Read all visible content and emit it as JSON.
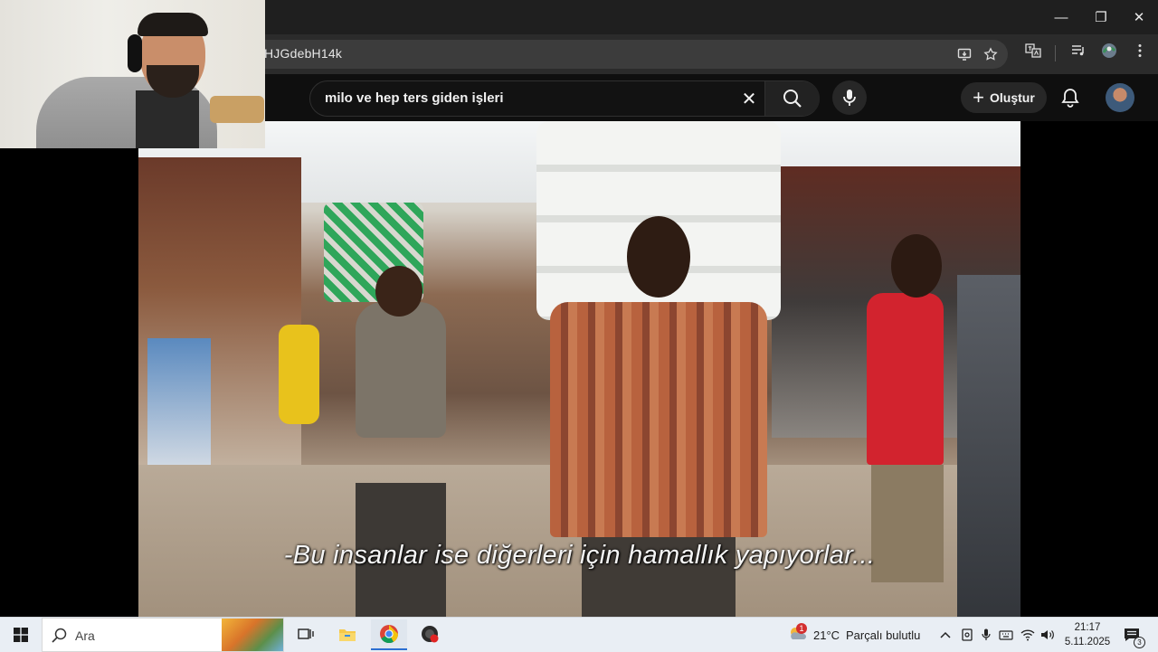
{
  "browser": {
    "window_controls": {
      "minimize": "—",
      "restore": "❐",
      "close": "✕"
    },
    "url_visible": "HJGdebH14k"
  },
  "youtube": {
    "search_query": "milo ve hep ters giden işleri",
    "clear_symbol": "✕",
    "create_label": "Oluştur",
    "create_plus": "+"
  },
  "video": {
    "subtitle": "-Bu insanlar ise diğerleri için hamallık yapıyorlar..."
  },
  "taskbar": {
    "search_placeholder": "Ara",
    "weather": {
      "temperature": "21°C",
      "condition": "Parçalı bulutlu",
      "alert_count": "1"
    },
    "clock": {
      "time": "21:17",
      "date": "5.11.2025"
    },
    "notification_count": "3"
  },
  "colors": {
    "browser_bg": "#1f1f1f",
    "youtube_bg": "#0f0f0f",
    "taskbar_bg": "#e9eef4",
    "chrome_red": "#db4437",
    "chrome_yellow": "#f4c20d",
    "chrome_green": "#0f9d58",
    "chrome_blue": "#4285f4"
  }
}
